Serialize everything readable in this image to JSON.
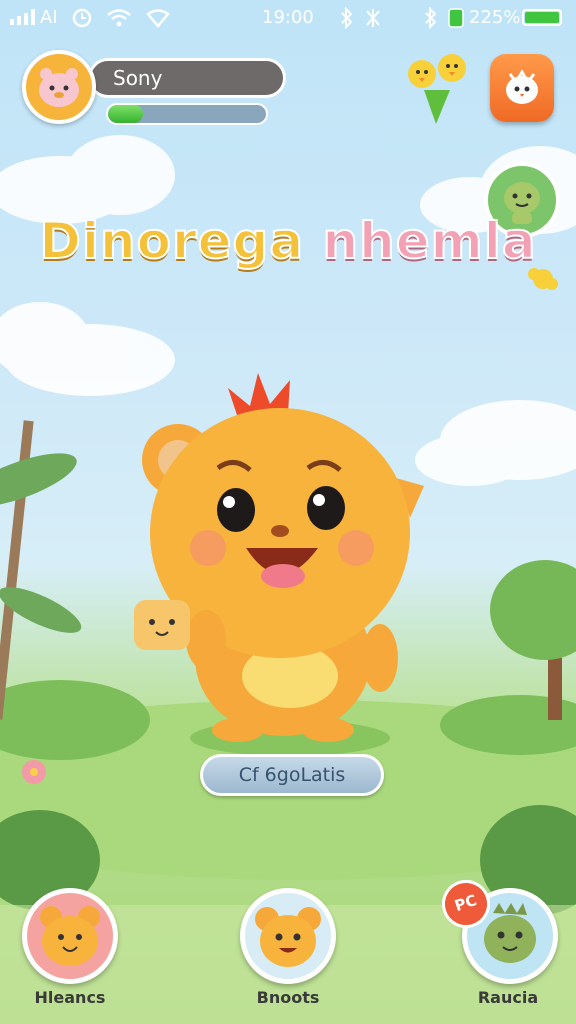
{
  "status_bar": {
    "left": "AI",
    "time": "19:00",
    "battery": "225%"
  },
  "player": {
    "name": "Sony",
    "xp_fraction": 0.22
  },
  "title": {
    "part1": "Dinorega",
    "part2": "nhemla"
  },
  "pet_status_label": "Cf 6goLatis",
  "bottom_nav": [
    {
      "label": "Hleancs"
    },
    {
      "label": "Bnoots"
    },
    {
      "label": "Raucia",
      "badge": "PC"
    }
  ],
  "icons": [
    "signal-icon",
    "clock-icon",
    "wifi-icon",
    "bluetooth-icon",
    "battery-icon",
    "profile-avatar-icon",
    "chicks-icon",
    "egg-shop-icon",
    "friend-icon",
    "pet-character"
  ]
}
